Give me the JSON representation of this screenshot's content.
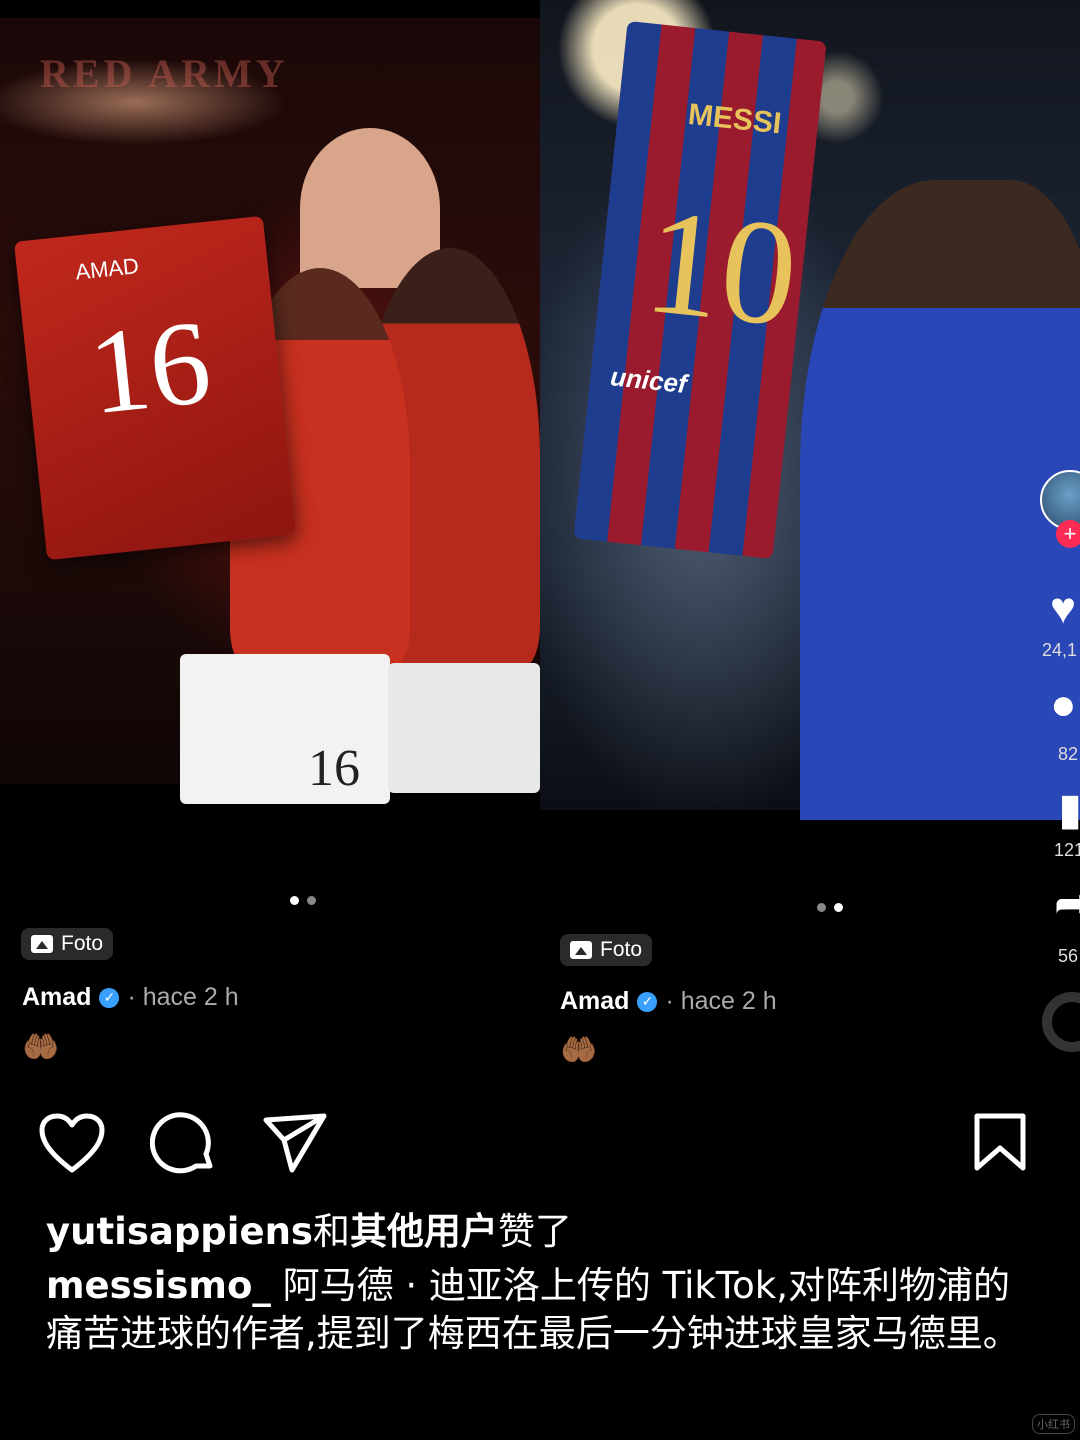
{
  "left_post": {
    "badge_label": "Foto",
    "author": "Amad",
    "verified_mark": "✓",
    "time": "· hace 2 h",
    "emoji": "🤲🏾",
    "image_texts": {
      "banner": "RED ARMY",
      "shirt_name": "AMAD",
      "shirt_number": "16",
      "shorts_number": "16"
    }
  },
  "right_post": {
    "badge_label": "Foto",
    "author": "Amad",
    "verified_mark": "✓",
    "time": "· hace 2 h",
    "emoji": "🤲🏾",
    "image_texts": {
      "shirt_name": "MESSI",
      "shirt_number": "10",
      "sponsor": "unicef"
    },
    "side_rail": {
      "plus": "+",
      "likes": "24,1",
      "comments": "82",
      "saves": "121",
      "shares": "56"
    }
  },
  "actions": {
    "icons": [
      "heart-icon",
      "comment-icon",
      "share-icon",
      "bookmark-icon"
    ]
  },
  "likes": {
    "user": "yutisappiens",
    "connector": "和",
    "others": "其他用户",
    "suffix": "赞了"
  },
  "caption": {
    "username": "messismo_",
    "text": " 阿马德 · 迪亚洛上传的 TikTok,对阵利物浦的痛苦进球的作者,提到了梅西在最后一分钟进球皇家马德里。"
  },
  "watermark": "小红书",
  "colors": {
    "background": "#000000",
    "verified": "#3aa0ff",
    "tiktok_plus": "#fe2c55"
  }
}
